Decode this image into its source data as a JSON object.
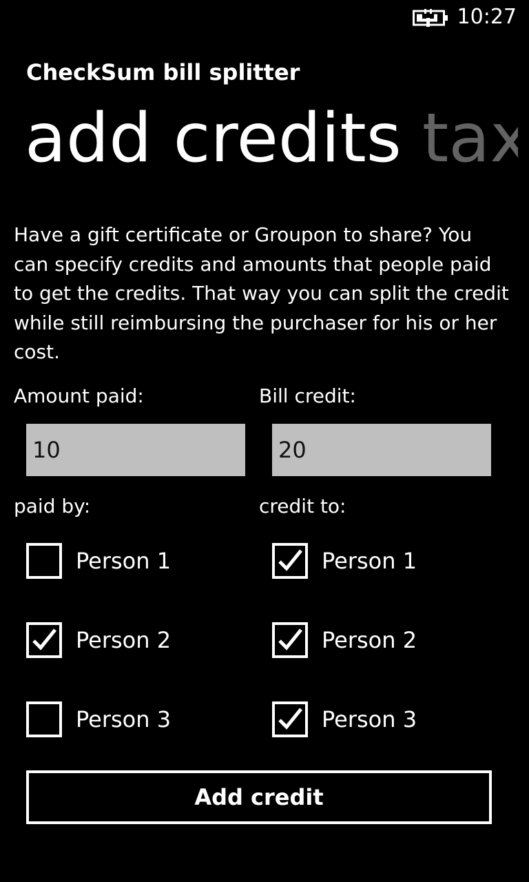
{
  "status_bar": {
    "time": "10:27",
    "battery_icon": "battery-charging-icon"
  },
  "app": {
    "title": "CheckSum bill splitter"
  },
  "pivot": {
    "active_tab": "add credits",
    "next_tab": "tax"
  },
  "description": {
    "lines": [
      "Have a gift certificate or Groupon to share?  You",
      "can specify credits and amounts that people paid",
      "to get the credits. That way you can split the credit",
      "while still reimbursing the purchaser for his or her",
      "cost."
    ]
  },
  "form": {
    "amount_label": "Amount paid:",
    "amount_value": "10",
    "credit_label": "Bill credit:",
    "credit_value": "20"
  },
  "paid_by": {
    "label": "paid by:",
    "people": [
      {
        "name": "Person 1",
        "checked": false
      },
      {
        "name": "Person 2",
        "checked": true
      },
      {
        "name": "Person 3",
        "checked": false
      }
    ]
  },
  "credit_to": {
    "label": "credit to:",
    "people": [
      {
        "name": "Person 1",
        "checked": true
      },
      {
        "name": "Person 2",
        "checked": true
      },
      {
        "name": "Person 3",
        "checked": true
      }
    ]
  },
  "actions": {
    "add_credit_label": "Add credit"
  }
}
